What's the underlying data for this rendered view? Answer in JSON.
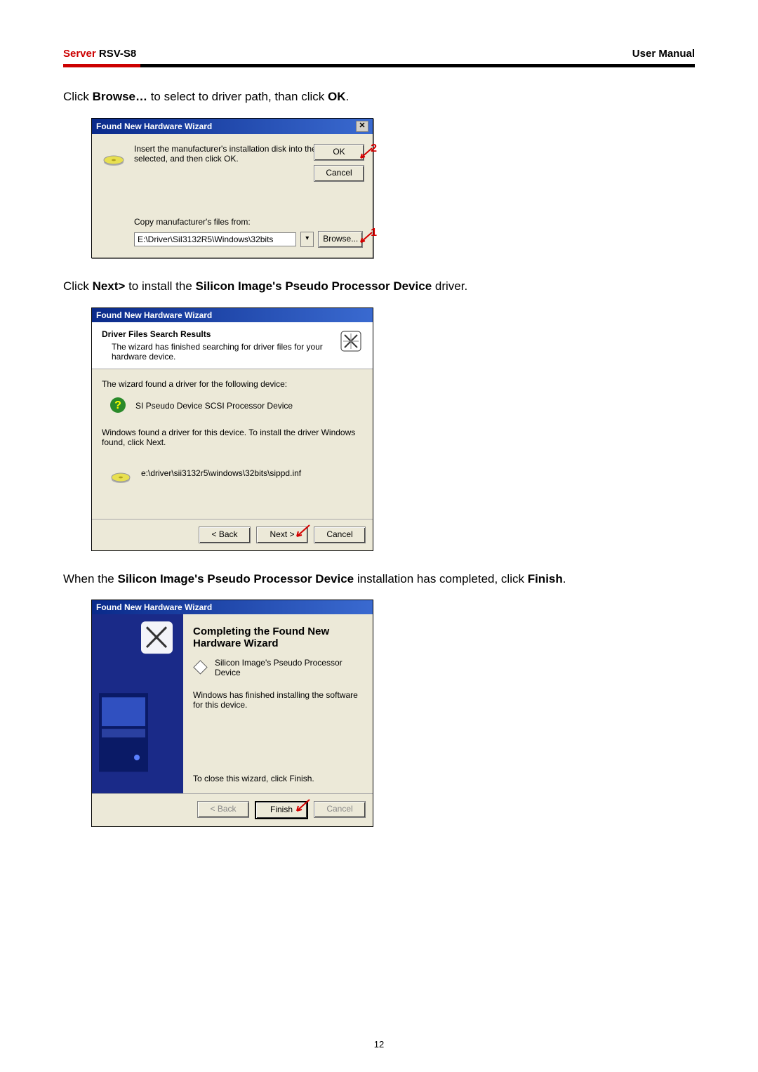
{
  "header": {
    "brand_prefix": "Server",
    "brand_model": " RSV-S8",
    "right": "User Manual"
  },
  "instr1": {
    "pre": "Click ",
    "b1": "Browse…",
    "mid": " to select to driver path, than click ",
    "b2": "OK",
    "post": "."
  },
  "dlg1": {
    "title": "Found New Hardware Wizard",
    "msg": "Insert the manufacturer's installation disk into the drive selected, and then click OK.",
    "ok": "OK",
    "cancel": "Cancel",
    "copy_from": "Copy manufacturer's files from:",
    "path": "E:\\Driver\\SiI3132R5\\Windows\\32bits",
    "browse": "Browse...",
    "callout_ok": "2",
    "callout_browse": "1"
  },
  "instr2": {
    "pre": "Click ",
    "b1": "Next>",
    "mid": " to install the ",
    "b2": "Silicon Image's Pseudo Processor Device",
    "post": " driver."
  },
  "dlg2": {
    "title": "Found New Hardware Wizard",
    "htitle": "Driver Files Search Results",
    "hsub": "The wizard has finished searching for driver files for your hardware device.",
    "found": "The wizard found a driver for the following device:",
    "device": "SI Pseudo Device SCSI Processor Device",
    "foundmsg": "Windows found a driver for this device. To install the driver Windows found, click Next.",
    "inf": "e:\\driver\\sii3132r5\\windows\\32bits\\sippd.inf",
    "back": "< Back",
    "next": "Next >",
    "cancel": "Cancel"
  },
  "instr3": {
    "pre": "When the ",
    "b1": "Silicon Image's Pseudo Processor Device",
    "mid": " installation has completed, click ",
    "b2": "Finish",
    "post": "."
  },
  "dlg3": {
    "title": "Found New Hardware Wizard",
    "h": "Completing the Found New Hardware Wizard",
    "device": "Silicon Image's Pseudo Processor Device",
    "done": "Windows has finished installing the software for this device.",
    "close": "To close this wizard, click Finish.",
    "back": "< Back",
    "finish": "Finish",
    "cancel": "Cancel"
  },
  "page_number": "12"
}
